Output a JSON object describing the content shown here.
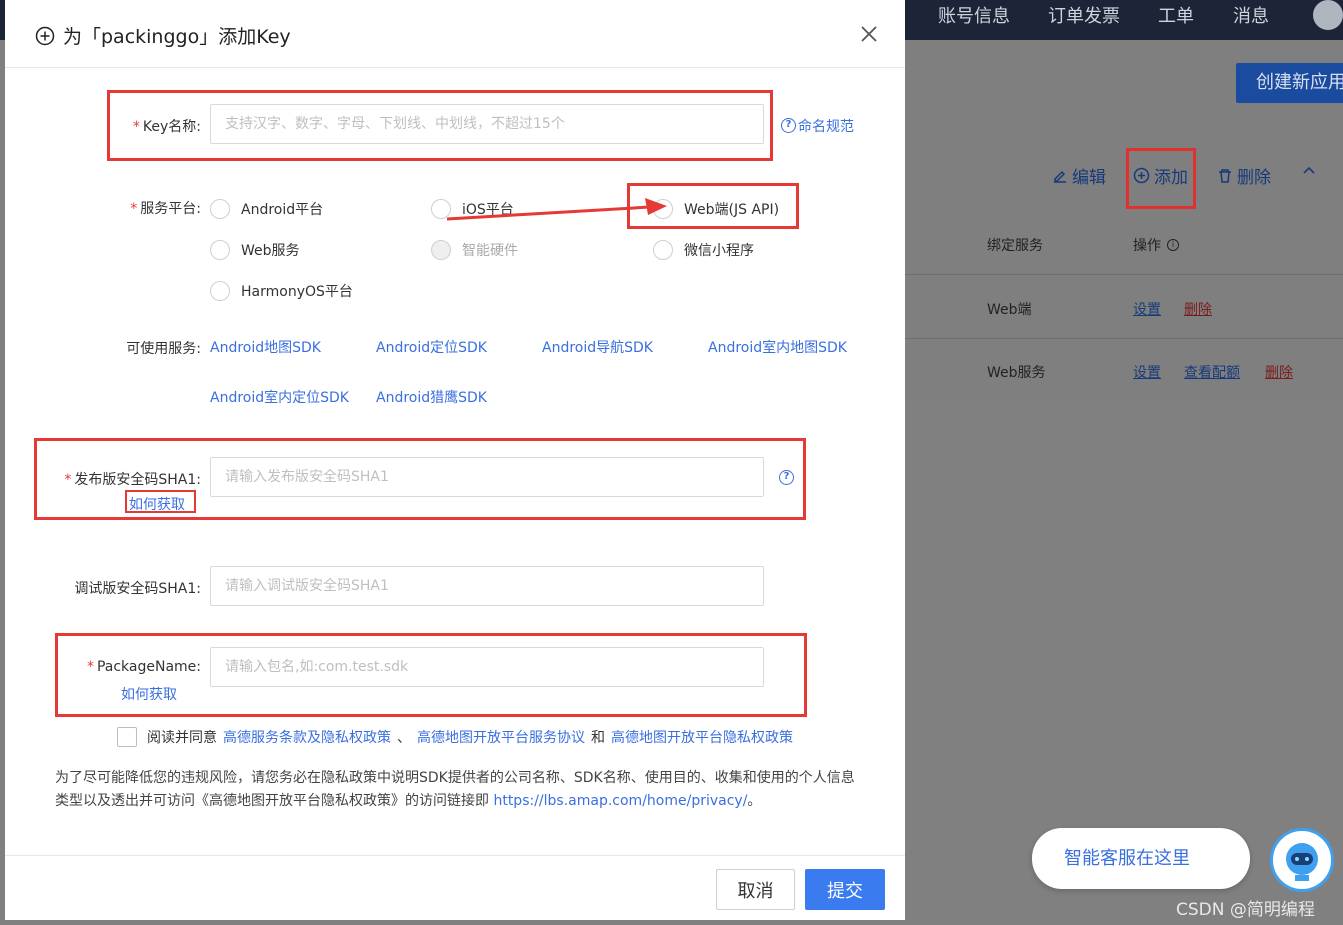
{
  "background": {
    "nav": [
      "账号信息",
      "订单发票",
      "工单",
      "消息"
    ],
    "create_button": "创建新应用",
    "actions": {
      "edit": "编辑",
      "add": "添加",
      "delete": "删除"
    },
    "table": {
      "headers": [
        "绑定服务",
        "操作"
      ],
      "rows": [
        {
          "service": "Web端",
          "ops": [
            "设置",
            "删除"
          ]
        },
        {
          "service": "Web服务",
          "ops": [
            "设置",
            "查看配额",
            "删除"
          ]
        }
      ]
    },
    "chat": "智能客服在这里",
    "watermark": "CSDN @简明编程"
  },
  "dialog": {
    "title": "为「packinggo」添加Key",
    "key_name": {
      "label": "Key名称:",
      "placeholder": "支持汉字、数字、字母、下划线、中划线，不超过15个",
      "help": "命名规范"
    },
    "platform": {
      "label": "服务平台:",
      "options": [
        "Android平台",
        "iOS平台",
        "Web端(JS API)",
        "Web服务",
        "智能硬件",
        "微信小程序",
        "HarmonyOS平台"
      ]
    },
    "services": {
      "label": "可使用服务:",
      "items": [
        "Android地图SDK",
        "Android定位SDK",
        "Android导航SDK",
        "Android室内地图SDK",
        "Android室内定位SDK",
        "Android猎鹰SDK"
      ]
    },
    "release_sha1": {
      "label": "发布版安全码SHA1:",
      "placeholder": "请输入发布版安全码SHA1",
      "how": "如何获取"
    },
    "debug_sha1": {
      "label": "调试版安全码SHA1:",
      "placeholder": "请输入调试版安全码SHA1"
    },
    "package_name": {
      "label": "PackageName:",
      "placeholder": "请输入包名,如:com.test.sdk",
      "how": "如何获取"
    },
    "agreement": {
      "prefix": "阅读并同意",
      "link1": "高德服务条款及隐私权政策",
      "sep1": "、",
      "link2": "高德地图开放平台服务协议",
      "sep2": "和",
      "link3": "高德地图开放平台隐私权政策"
    },
    "notice": {
      "text": "为了尽可能降低您的违规风险，请您务必在隐私政策中说明SDK提供者的公司名称、SDK名称、使用目的、收集和使用的个人信息类型以及透出并可访问《高德地图开放平台隐私权政策》的访问链接即",
      "url": "https://lbs.amap.com/home/privacy/",
      "end": "。"
    },
    "buttons": {
      "cancel": "取消",
      "submit": "提交"
    }
  },
  "colors": {
    "accent": "#3a7bf0",
    "link": "#3a6fe0",
    "annotation": "#e53935"
  }
}
